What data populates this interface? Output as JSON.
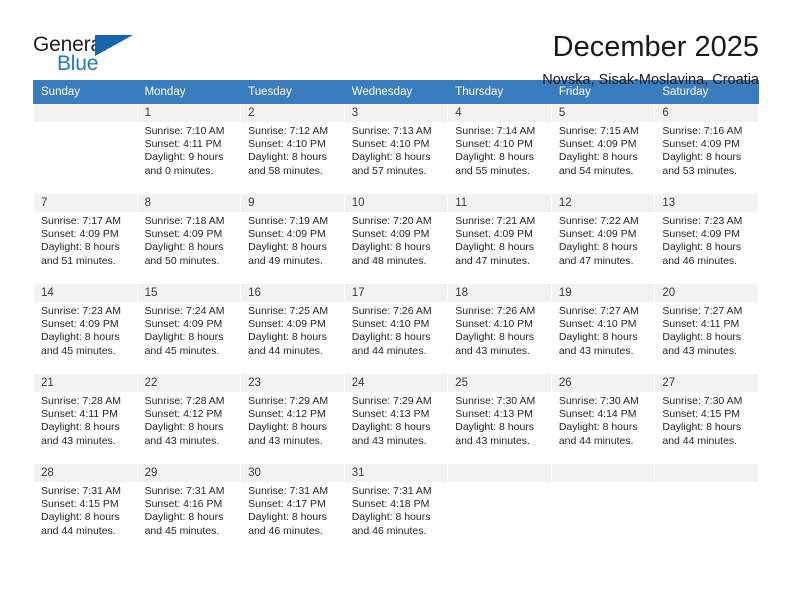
{
  "logo": {
    "word_top": "General",
    "word_bottom": "Blue",
    "triangle_color": "#1566b0",
    "blue_color": "#1f7ac4",
    "dark_color": "#231f20"
  },
  "header": {
    "month_title": "December 2025",
    "location": "Novska, Sisak-Moslavina, Croatia"
  },
  "theme": {
    "header_bg": "#3a7dbf",
    "header_text": "#ffffff",
    "daynum_bg": "#f2f2f2",
    "body_text": "#262626"
  },
  "calendar": {
    "weekdays": [
      "Sunday",
      "Monday",
      "Tuesday",
      "Wednesday",
      "Thursday",
      "Friday",
      "Saturday"
    ],
    "weeks": [
      [
        {
          "day": "",
          "sunrise": "",
          "sunset": "",
          "daylight1": "",
          "daylight2": "",
          "empty": true
        },
        {
          "day": "1",
          "sunrise": "Sunrise: 7:10 AM",
          "sunset": "Sunset: 4:11 PM",
          "daylight1": "Daylight: 9 hours",
          "daylight2": "and 0 minutes."
        },
        {
          "day": "2",
          "sunrise": "Sunrise: 7:12 AM",
          "sunset": "Sunset: 4:10 PM",
          "daylight1": "Daylight: 8 hours",
          "daylight2": "and 58 minutes."
        },
        {
          "day": "3",
          "sunrise": "Sunrise: 7:13 AM",
          "sunset": "Sunset: 4:10 PM",
          "daylight1": "Daylight: 8 hours",
          "daylight2": "and 57 minutes."
        },
        {
          "day": "4",
          "sunrise": "Sunrise: 7:14 AM",
          "sunset": "Sunset: 4:10 PM",
          "daylight1": "Daylight: 8 hours",
          "daylight2": "and 55 minutes."
        },
        {
          "day": "5",
          "sunrise": "Sunrise: 7:15 AM",
          "sunset": "Sunset: 4:09 PM",
          "daylight1": "Daylight: 8 hours",
          "daylight2": "and 54 minutes."
        },
        {
          "day": "6",
          "sunrise": "Sunrise: 7:16 AM",
          "sunset": "Sunset: 4:09 PM",
          "daylight1": "Daylight: 8 hours",
          "daylight2": "and 53 minutes."
        }
      ],
      [
        {
          "day": "7",
          "sunrise": "Sunrise: 7:17 AM",
          "sunset": "Sunset: 4:09 PM",
          "daylight1": "Daylight: 8 hours",
          "daylight2": "and 51 minutes."
        },
        {
          "day": "8",
          "sunrise": "Sunrise: 7:18 AM",
          "sunset": "Sunset: 4:09 PM",
          "daylight1": "Daylight: 8 hours",
          "daylight2": "and 50 minutes."
        },
        {
          "day": "9",
          "sunrise": "Sunrise: 7:19 AM",
          "sunset": "Sunset: 4:09 PM",
          "daylight1": "Daylight: 8 hours",
          "daylight2": "and 49 minutes."
        },
        {
          "day": "10",
          "sunrise": "Sunrise: 7:20 AM",
          "sunset": "Sunset: 4:09 PM",
          "daylight1": "Daylight: 8 hours",
          "daylight2": "and 48 minutes."
        },
        {
          "day": "11",
          "sunrise": "Sunrise: 7:21 AM",
          "sunset": "Sunset: 4:09 PM",
          "daylight1": "Daylight: 8 hours",
          "daylight2": "and 47 minutes."
        },
        {
          "day": "12",
          "sunrise": "Sunrise: 7:22 AM",
          "sunset": "Sunset: 4:09 PM",
          "daylight1": "Daylight: 8 hours",
          "daylight2": "and 47 minutes."
        },
        {
          "day": "13",
          "sunrise": "Sunrise: 7:23 AM",
          "sunset": "Sunset: 4:09 PM",
          "daylight1": "Daylight: 8 hours",
          "daylight2": "and 46 minutes."
        }
      ],
      [
        {
          "day": "14",
          "sunrise": "Sunrise: 7:23 AM",
          "sunset": "Sunset: 4:09 PM",
          "daylight1": "Daylight: 8 hours",
          "daylight2": "and 45 minutes."
        },
        {
          "day": "15",
          "sunrise": "Sunrise: 7:24 AM",
          "sunset": "Sunset: 4:09 PM",
          "daylight1": "Daylight: 8 hours",
          "daylight2": "and 45 minutes."
        },
        {
          "day": "16",
          "sunrise": "Sunrise: 7:25 AM",
          "sunset": "Sunset: 4:09 PM",
          "daylight1": "Daylight: 8 hours",
          "daylight2": "and 44 minutes."
        },
        {
          "day": "17",
          "sunrise": "Sunrise: 7:26 AM",
          "sunset": "Sunset: 4:10 PM",
          "daylight1": "Daylight: 8 hours",
          "daylight2": "and 44 minutes."
        },
        {
          "day": "18",
          "sunrise": "Sunrise: 7:26 AM",
          "sunset": "Sunset: 4:10 PM",
          "daylight1": "Daylight: 8 hours",
          "daylight2": "and 43 minutes."
        },
        {
          "day": "19",
          "sunrise": "Sunrise: 7:27 AM",
          "sunset": "Sunset: 4:10 PM",
          "daylight1": "Daylight: 8 hours",
          "daylight2": "and 43 minutes."
        },
        {
          "day": "20",
          "sunrise": "Sunrise: 7:27 AM",
          "sunset": "Sunset: 4:11 PM",
          "daylight1": "Daylight: 8 hours",
          "daylight2": "and 43 minutes."
        }
      ],
      [
        {
          "day": "21",
          "sunrise": "Sunrise: 7:28 AM",
          "sunset": "Sunset: 4:11 PM",
          "daylight1": "Daylight: 8 hours",
          "daylight2": "and 43 minutes."
        },
        {
          "day": "22",
          "sunrise": "Sunrise: 7:28 AM",
          "sunset": "Sunset: 4:12 PM",
          "daylight1": "Daylight: 8 hours",
          "daylight2": "and 43 minutes."
        },
        {
          "day": "23",
          "sunrise": "Sunrise: 7:29 AM",
          "sunset": "Sunset: 4:12 PM",
          "daylight1": "Daylight: 8 hours",
          "daylight2": "and 43 minutes."
        },
        {
          "day": "24",
          "sunrise": "Sunrise: 7:29 AM",
          "sunset": "Sunset: 4:13 PM",
          "daylight1": "Daylight: 8 hours",
          "daylight2": "and 43 minutes."
        },
        {
          "day": "25",
          "sunrise": "Sunrise: 7:30 AM",
          "sunset": "Sunset: 4:13 PM",
          "daylight1": "Daylight: 8 hours",
          "daylight2": "and 43 minutes."
        },
        {
          "day": "26",
          "sunrise": "Sunrise: 7:30 AM",
          "sunset": "Sunset: 4:14 PM",
          "daylight1": "Daylight: 8 hours",
          "daylight2": "and 44 minutes."
        },
        {
          "day": "27",
          "sunrise": "Sunrise: 7:30 AM",
          "sunset": "Sunset: 4:15 PM",
          "daylight1": "Daylight: 8 hours",
          "daylight2": "and 44 minutes."
        }
      ],
      [
        {
          "day": "28",
          "sunrise": "Sunrise: 7:31 AM",
          "sunset": "Sunset: 4:15 PM",
          "daylight1": "Daylight: 8 hours",
          "daylight2": "and 44 minutes."
        },
        {
          "day": "29",
          "sunrise": "Sunrise: 7:31 AM",
          "sunset": "Sunset: 4:16 PM",
          "daylight1": "Daylight: 8 hours",
          "daylight2": "and 45 minutes."
        },
        {
          "day": "30",
          "sunrise": "Sunrise: 7:31 AM",
          "sunset": "Sunset: 4:17 PM",
          "daylight1": "Daylight: 8 hours",
          "daylight2": "and 46 minutes."
        },
        {
          "day": "31",
          "sunrise": "Sunrise: 7:31 AM",
          "sunset": "Sunset: 4:18 PM",
          "daylight1": "Daylight: 8 hours",
          "daylight2": "and 46 minutes."
        },
        {
          "day": "",
          "sunrise": "",
          "sunset": "",
          "daylight1": "",
          "daylight2": "",
          "empty": true
        },
        {
          "day": "",
          "sunrise": "",
          "sunset": "",
          "daylight1": "",
          "daylight2": "",
          "empty": true
        },
        {
          "day": "",
          "sunrise": "",
          "sunset": "",
          "daylight1": "",
          "daylight2": "",
          "empty": true
        }
      ]
    ]
  }
}
